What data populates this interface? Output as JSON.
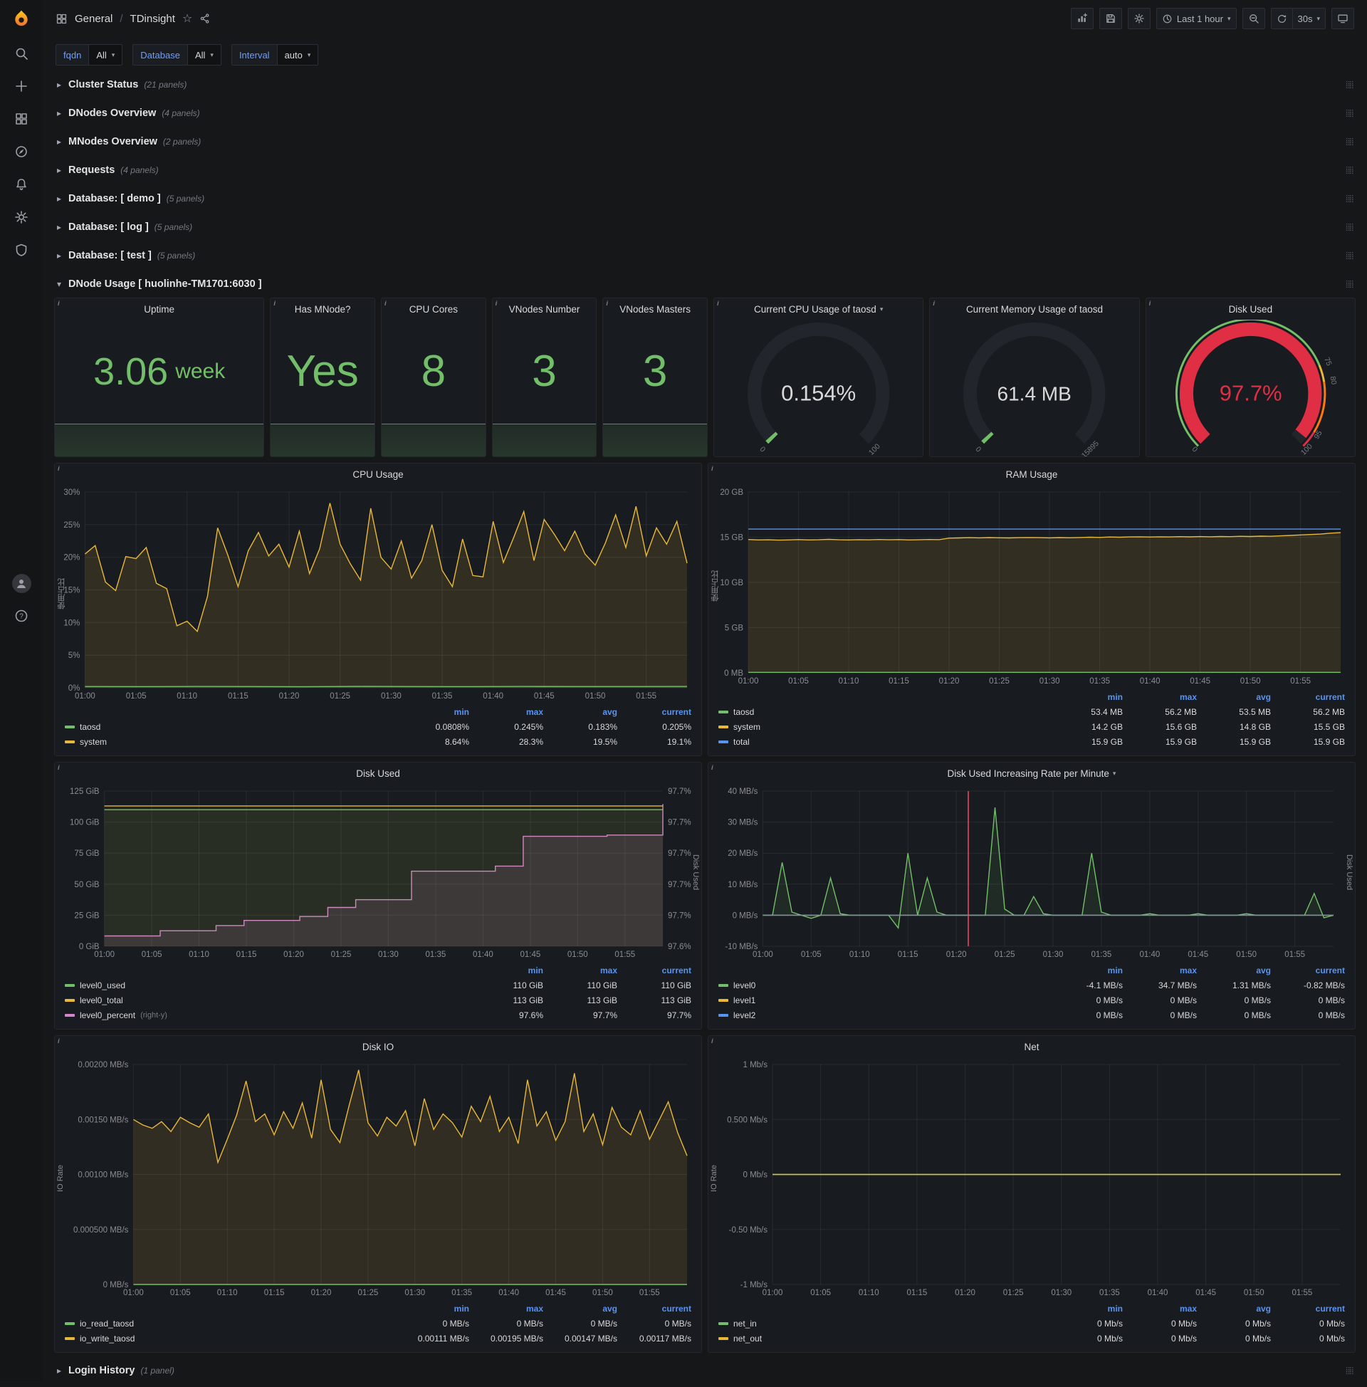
{
  "app": {
    "breadcrumb": {
      "section": "General",
      "separator": "/",
      "title": "TDinsight"
    },
    "toolbar": {
      "time_range": "Last 1 hour",
      "refresh": "30s"
    }
  },
  "variables": [
    {
      "label": "fqdn",
      "value": "All"
    },
    {
      "label": "Database",
      "value": "All"
    },
    {
      "label": "Interval",
      "value": "auto"
    }
  ],
  "rows": [
    {
      "title": "Cluster Status",
      "count": "(21 panels)"
    },
    {
      "title": "DNodes Overview",
      "count": "(4 panels)"
    },
    {
      "title": "MNodes Overview",
      "count": "(2 panels)"
    },
    {
      "title": "Requests",
      "count": "(4 panels)"
    },
    {
      "title": "Database: [ demo ]",
      "count": "(5 panels)"
    },
    {
      "title": "Database: [ log ]",
      "count": "(5 panels)"
    },
    {
      "title": "Database: [ test ]",
      "count": "(5 panels)"
    }
  ],
  "dnode_row": {
    "title": "DNode Usage [ huolinhe-TM1701:6030 ]"
  },
  "login_row": {
    "title": "Login History",
    "count": "(1 panel)"
  },
  "stats": [
    {
      "title": "Uptime",
      "value": "3.06",
      "unit": "week"
    },
    {
      "title": "Has MNode?",
      "value": "Yes",
      "unit": ""
    },
    {
      "title": "CPU Cores",
      "value": "8",
      "unit": ""
    },
    {
      "title": "VNodes Number",
      "value": "3",
      "unit": ""
    },
    {
      "title": "VNodes Masters",
      "value": "3",
      "unit": ""
    }
  ],
  "gauges": {
    "cpu": {
      "title": "Current CPU Usage of taosd",
      "value": "0.154%",
      "fraction": 0.00154,
      "color": "#73BF69",
      "value_color": "#d8d9da",
      "thresholds": [
        {
          "at": 0,
          "label": "0"
        },
        {
          "at": 1,
          "label": "100"
        }
      ]
    },
    "mem": {
      "title": "Current Memory Usage of taosd",
      "value": "61.4 MB",
      "fraction": 0.004,
      "color": "#73BF69",
      "value_color": "#d8d9da",
      "thresholds": [
        {
          "at": 0,
          "label": "0"
        },
        {
          "at": 1,
          "label": "15895"
        }
      ]
    },
    "disk": {
      "title": "Disk Used",
      "value": "97.7%",
      "fraction": 0.977,
      "color": "#E02F44",
      "value_color": "#E02F44",
      "thresholds": [
        {
          "at": 0,
          "label": "0"
        },
        {
          "at": 0.75,
          "label": "75"
        },
        {
          "at": 0.8,
          "label": "80"
        },
        {
          "at": 0.95,
          "label": "95"
        },
        {
          "at": 1,
          "label": "100"
        }
      ],
      "bands": [
        {
          "from": 0,
          "to": 0.75,
          "color": "#73BF69"
        },
        {
          "from": 0.75,
          "to": 0.8,
          "color": "#EAB839"
        },
        {
          "from": 0.8,
          "to": 0.95,
          "color": "#FF780A"
        },
        {
          "from": 0.95,
          "to": 1,
          "color": "#E02F44"
        }
      ]
    }
  },
  "charts": {
    "xticks": [
      "01:00",
      "01:05",
      "01:10",
      "01:15",
      "01:20",
      "01:25",
      "01:30",
      "01:35",
      "01:40",
      "01:45",
      "01:50",
      "01:55"
    ],
    "cpu": {
      "title": "CPU Usage",
      "ylabel": "使用占比",
      "range": [
        0,
        30
      ],
      "yticks": [
        "30%",
        "25%",
        "20%",
        "15%",
        "10%",
        "5%",
        "0%"
      ],
      "series": [
        {
          "name": "system",
          "color": "#EAB839",
          "fill": 0.13,
          "data": [
            20.5,
            21.8,
            16.2,
            14.9,
            20.1,
            19.8,
            21.5,
            16.0,
            15.2,
            9.5,
            10.2,
            8.64,
            14.0,
            24.5,
            20.3,
            15.5,
            21.0,
            23.8,
            20.2,
            22.0,
            18.5,
            24.0,
            17.5,
            21.3,
            28.3,
            22.0,
            19.0,
            16.5,
            27.5,
            20.0,
            18.2,
            22.5,
            16.8,
            19.5,
            25.0,
            18.0,
            15.5,
            22.8,
            17.2,
            17.0,
            25.5,
            19.2,
            23.0,
            27.0,
            19.5,
            25.8,
            23.5,
            21.0,
            24.0,
            20.5,
            18.8,
            22.2,
            26.5,
            21.5,
            27.8,
            20.2,
            24.5,
            22.0,
            25.5,
            19.1
          ]
        },
        {
          "name": "taosd",
          "color": "#73BF69",
          "fill": 0.15,
          "data": [
            0.2,
            0.19,
            0.21,
            0.2,
            0.18,
            0.22,
            0.2,
            0.19,
            0.21,
            0.2,
            0.2,
            0.205
          ]
        }
      ],
      "legend": {
        "cols": [
          "min",
          "max",
          "avg",
          "current"
        ],
        "rows": [
          {
            "name": "taosd",
            "color": "#73BF69",
            "values": [
              "0.0808%",
              "0.245%",
              "0.183%",
              "0.205%"
            ]
          },
          {
            "name": "system",
            "color": "#EAB839",
            "values": [
              "8.64%",
              "28.3%",
              "19.5%",
              "19.1%"
            ]
          }
        ]
      }
    },
    "ram": {
      "title": "RAM Usage",
      "ylabel": "使用占比",
      "range": [
        0,
        20
      ],
      "yticks": [
        "20 GB",
        "15 GB",
        "10 GB",
        "5 GB",
        "0 MB"
      ],
      "series": [
        {
          "name": "system",
          "color": "#EAB839",
          "fill": 0.13,
          "data": [
            14.75,
            14.7,
            14.72,
            14.68,
            14.7,
            14.74,
            14.7,
            14.72,
            14.76,
            14.72,
            14.7,
            14.73,
            14.71,
            14.75,
            14.72,
            14.74,
            14.7,
            14.72,
            14.75,
            14.73,
            14.9,
            14.92,
            14.95,
            14.93,
            14.96,
            14.94,
            14.92,
            14.95,
            14.97,
            14.95,
            14.93,
            14.96,
            14.94,
            14.97,
            15.0,
            14.98,
            15.02,
            15.0,
            15.03,
            15.05,
            15.02,
            15.05,
            15.03,
            15.06,
            15.04,
            15.07,
            15.05,
            15.08,
            15.06,
            15.1,
            15.08,
            15.12,
            15.1,
            15.15,
            15.2,
            15.25,
            15.3,
            15.35,
            15.45,
            15.5
          ]
        },
        {
          "name": "total",
          "color": "#5794F2",
          "data": [
            15.9,
            15.9
          ]
        },
        {
          "name": "taosd",
          "color": "#73BF69",
          "data": [
            0.053,
            0.055
          ]
        }
      ],
      "legend": {
        "cols": [
          "min",
          "max",
          "avg",
          "current"
        ],
        "rows": [
          {
            "name": "taosd",
            "color": "#73BF69",
            "values": [
              "53.4 MB",
              "56.2 MB",
              "53.5 MB",
              "56.2 MB"
            ]
          },
          {
            "name": "system",
            "color": "#EAB839",
            "values": [
              "14.2 GB",
              "15.6 GB",
              "14.8 GB",
              "15.5 GB"
            ]
          },
          {
            "name": "total",
            "color": "#5794F2",
            "values": [
              "15.9 GB",
              "15.9 GB",
              "15.9 GB",
              "15.9 GB"
            ]
          }
        ]
      }
    },
    "disk": {
      "title": "Disk Used",
      "ylabel2": "Disk Used",
      "range": [
        0,
        125
      ],
      "range2": [
        97.59,
        97.71
      ],
      "yticks": [
        "125 GiB",
        "100 GiB",
        "75 GiB",
        "50 GiB",
        "25 GiB",
        "0 GiB"
      ],
      "yticks2": [
        "97.7%",
        "97.7%",
        "97.7%",
        "97.7%",
        "97.7%",
        "97.6%"
      ],
      "series": [
        {
          "name": "level0_percent",
          "color": "#D683CE",
          "fill": 0.13,
          "axis": 2,
          "step": true,
          "data": [
            97.598,
            97.598,
            97.602,
            97.602,
            97.606,
            97.61,
            97.61,
            97.613,
            97.62,
            97.626,
            97.626,
            97.648,
            97.648,
            97.648,
            97.652,
            97.675,
            97.675,
            97.675,
            97.676,
            97.676,
            97.7
          ]
        },
        {
          "name": "level0_used",
          "color": "#73BF69",
          "fill": 0.08,
          "data": [
            110,
            110
          ]
        },
        {
          "name": "level0_total",
          "color": "#EAB839",
          "fill": 0.05,
          "data": [
            113,
            113
          ]
        }
      ],
      "legend": {
        "cols": [
          "min",
          "max",
          "current"
        ],
        "rows": [
          {
            "name": "level0_used",
            "color": "#73BF69",
            "values": [
              "110 GiB",
              "110 GiB",
              "110 GiB"
            ]
          },
          {
            "name": "level0_total",
            "color": "#EAB839",
            "values": [
              "113 GiB",
              "113 GiB",
              "113 GiB"
            ]
          },
          {
            "name": "level0_percent",
            "suffix": "(right-y)",
            "color": "#D683CE",
            "values": [
              "97.6%",
              "97.7%",
              "97.7%"
            ]
          }
        ]
      }
    },
    "rate": {
      "title": "Disk Used Increasing Rate per Minute",
      "ylabel2": "Disk Used",
      "range": [
        -10,
        40
      ],
      "annotation": 0.36,
      "yticks": [
        "40 MB/s",
        "30 MB/s",
        "20 MB/s",
        "10 MB/s",
        "0 MB/s",
        "-10 MB/s"
      ],
      "series": [
        {
          "name": "level0",
          "color": "#73BF69",
          "fill": 0.1,
          "data": [
            0,
            0,
            17,
            1,
            0,
            -1,
            0,
            12,
            0.5,
            0,
            0,
            0,
            0,
            0,
            -4.1,
            20,
            0,
            12,
            1,
            0,
            0,
            0,
            0,
            0,
            34.7,
            2,
            0,
            0,
            6,
            0.5,
            0,
            0,
            0,
            0,
            20,
            1,
            0,
            0,
            0,
            0,
            0.5,
            0,
            0,
            0,
            0,
            0.5,
            0,
            0,
            0,
            0,
            0.5,
            0,
            0,
            0,
            0,
            0,
            0,
            7,
            -0.82,
            0
          ]
        },
        {
          "name": "level1",
          "color": "#EAB839",
          "data": [
            0,
            0
          ]
        },
        {
          "name": "level2",
          "color": "#5794F2",
          "data": [
            0,
            0
          ]
        }
      ],
      "legend": {
        "cols": [
          "min",
          "max",
          "avg",
          "current"
        ],
        "rows": [
          {
            "name": "level0",
            "color": "#73BF69",
            "values": [
              "-4.1 MB/s",
              "34.7 MB/s",
              "1.31 MB/s",
              "-0.82 MB/s"
            ]
          },
          {
            "name": "level1",
            "color": "#EAB839",
            "values": [
              "0 MB/s",
              "0 MB/s",
              "0 MB/s",
              "0 MB/s"
            ]
          },
          {
            "name": "level2",
            "color": "#5794F2",
            "values": [
              "0 MB/s",
              "0 MB/s",
              "0 MB/s",
              "0 MB/s"
            ]
          }
        ]
      }
    },
    "io": {
      "title": "Disk IO",
      "ylabel": "IO Rate",
      "range": [
        0,
        0.002
      ],
      "yticks": [
        "0.00200 MB/s",
        "0.00150 MB/s",
        "0.00100 MB/s",
        "0.000500 MB/s",
        "0 MB/s"
      ],
      "series": [
        {
          "name": "io_write_taosd",
          "color": "#EAB839",
          "fill": 0.12,
          "data": [
            0.0015,
            0.00145,
            0.00142,
            0.00148,
            0.00139,
            0.00152,
            0.00147,
            0.00143,
            0.00155,
            0.00111,
            0.00132,
            0.00154,
            0.00185,
            0.00148,
            0.00155,
            0.00136,
            0.00157,
            0.00142,
            0.00165,
            0.00133,
            0.00186,
            0.00141,
            0.00129,
            0.00163,
            0.00195,
            0.00147,
            0.00135,
            0.00152,
            0.00144,
            0.00158,
            0.00126,
            0.00169,
            0.00141,
            0.00155,
            0.00147,
            0.00134,
            0.00162,
            0.00148,
            0.00171,
            0.00139,
            0.00152,
            0.00128,
            0.00186,
            0.00144,
            0.00157,
            0.00131,
            0.00148,
            0.00192,
            0.00139,
            0.00155,
            0.00127,
            0.00161,
            0.00143,
            0.00136,
            0.00158,
            0.00132,
            0.00149,
            0.00166,
            0.00138,
            0.00117
          ]
        },
        {
          "name": "io_read_taosd",
          "color": "#73BF69",
          "data": [
            0,
            0
          ]
        }
      ],
      "legend": {
        "cols": [
          "min",
          "max",
          "avg",
          "current"
        ],
        "rows": [
          {
            "name": "io_read_taosd",
            "color": "#73BF69",
            "values": [
              "0 MB/s",
              "0 MB/s",
              "0 MB/s",
              "0 MB/s"
            ]
          },
          {
            "name": "io_write_taosd",
            "color": "#EAB839",
            "values": [
              "0.00111 MB/s",
              "0.00195 MB/s",
              "0.00147 MB/s",
              "0.00117 MB/s"
            ]
          }
        ]
      }
    },
    "net": {
      "title": "Net",
      "ylabel": "IO Rate",
      "range": [
        -1,
        1
      ],
      "yticks": [
        "1 Mb/s",
        "0.500 Mb/s",
        "0 Mb/s",
        "-0.50 Mb/s",
        "-1 Mb/s"
      ],
      "series": [
        {
          "name": "net_in",
          "color": "#73BF69",
          "data": [
            0,
            0
          ]
        },
        {
          "name": "net_out",
          "color": "#EAB839",
          "data": [
            0,
            0
          ]
        }
      ],
      "legend": {
        "cols": [
          "min",
          "max",
          "avg",
          "current"
        ],
        "rows": [
          {
            "name": "net_in",
            "color": "#73BF69",
            "values": [
              "0 Mb/s",
              "0 Mb/s",
              "0 Mb/s",
              "0 Mb/s"
            ]
          },
          {
            "name": "net_out",
            "color": "#EAB839",
            "values": [
              "0 Mb/s",
              "0 Mb/s",
              "0 Mb/s",
              "0 Mb/s"
            ]
          }
        ]
      }
    }
  }
}
